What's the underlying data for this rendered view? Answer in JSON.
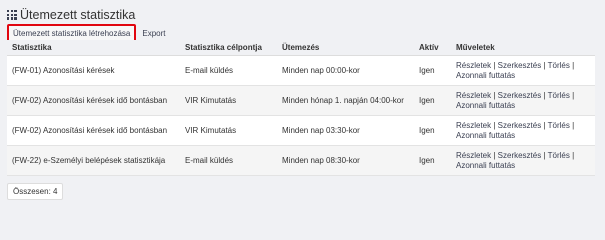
{
  "page": {
    "title": "Ütemezett statisztika"
  },
  "toolbar": {
    "create_label": "Ütemezett statisztika létrehozása",
    "export_label": "Export"
  },
  "table": {
    "headers": [
      "Statisztika",
      "Statisztika célpontja",
      "Ütemezés",
      "Aktív",
      "Műveletek"
    ],
    "rows": [
      {
        "name": "(FW-01) Azonosítási kérések",
        "target": "E-mail küldés",
        "schedule": "Minden nap 00:00-kor",
        "active": "Igen"
      },
      {
        "name": "(FW-02) Azonosítási kérések idő bontásban",
        "target": "VIR Kimutatás",
        "schedule": "Minden hónap 1. napján 04:00-kor",
        "active": "Igen"
      },
      {
        "name": "(FW-02) Azonosítási kérések idő bontásban",
        "target": "VIR Kimutatás",
        "schedule": "Minden nap 03:30-kor",
        "active": "Igen"
      },
      {
        "name": "(FW-22) e-Személyi belépések statisztikája",
        "target": "E-mail küldés",
        "schedule": "Minden nap 08:30-kor",
        "active": "Igen"
      }
    ],
    "ops": {
      "details": "Részletek",
      "edit": "Szerkesztés",
      "delete": "Törlés",
      "run": "Azonnali futtatás",
      "sep": " | "
    }
  },
  "footer": {
    "total_label": "Összesen: 4"
  }
}
